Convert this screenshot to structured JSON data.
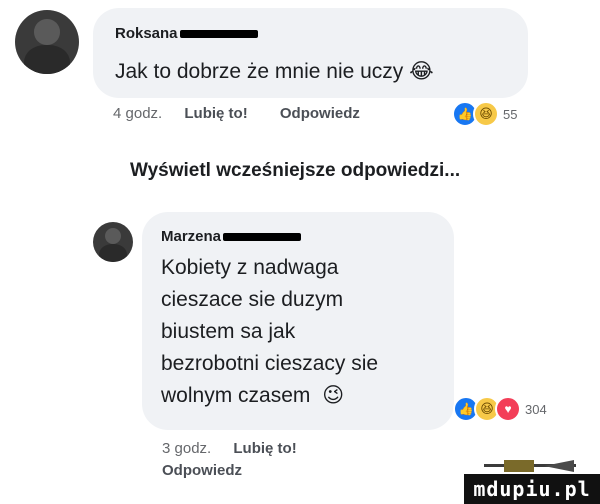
{
  "comment1": {
    "author": "Roksana",
    "text": "Jak to dobrze że mnie nie uczy",
    "emoji": "😂",
    "time": "4 godz.",
    "like": "Lubię to!",
    "reply": "Odpowiedz",
    "reaction_count": "55",
    "reactions": [
      "like-icon",
      "haha-icon"
    ]
  },
  "show_more": "Wyświetl wcześniejsze odpowiedzi...",
  "comment2": {
    "author": "Marzena",
    "lines": [
      "Kobiety z nadwaga",
      "cieszace sie duzym",
      "biustem sa jak",
      "bezrobotni cieszacy sie",
      "wolnym czasem"
    ],
    "emoji": "😉",
    "time": "3 godz.",
    "like": "Lubię to!",
    "reply": "Odpowiedz",
    "reaction_count": "304",
    "reactions": [
      "like-icon",
      "haha-icon",
      "love-icon"
    ]
  },
  "watermark": "mdupiu.pl",
  "colors": {
    "bubble": "#f0f2f5",
    "like": "#1877f2",
    "love": "#f33e58",
    "haha": "#f7c948"
  }
}
